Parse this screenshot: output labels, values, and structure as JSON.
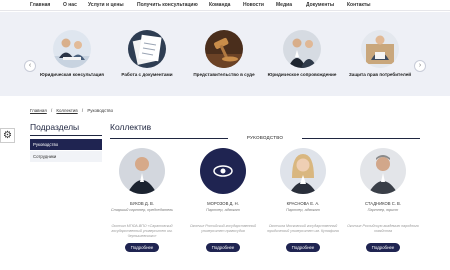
{
  "nav": {
    "items": [
      "Главная",
      "О нас",
      "Услуги и цены",
      "Получить консультацию",
      "Команда",
      "Новости",
      "Медиа",
      "Документы",
      "Контакты"
    ]
  },
  "services": {
    "prev_icon": "‹",
    "next_icon": "›",
    "items": [
      {
        "label": "Юридическая консультация"
      },
      {
        "label": "Работа с документами"
      },
      {
        "label": "Представительство в суде"
      },
      {
        "label": "Юридическое сопровождение"
      },
      {
        "label": "Защита прав потребителей"
      }
    ]
  },
  "breadcrumbs": [
    "Главная",
    "/",
    "Коллектив",
    "/",
    "Руководство"
  ],
  "settings_icon": "⚙",
  "sidebar": {
    "title": "Подразделы",
    "items": [
      "Руководство",
      "Сотрудники"
    ]
  },
  "main": {
    "title": "Коллектив",
    "subtitle": "РУКОВОДСТВО"
  },
  "team": [
    {
      "name": "БУКОВ Д. В.",
      "position": "Старший партнер, председатель",
      "description": "Окончил МГЮА-ВПО «Саратовский государственный университет им. Чернышевского»",
      "button": "Подробнее"
    },
    {
      "name": "МОРОЗОВ Д. Н.",
      "position": "Партнер, адвокат",
      "description": "Окончил Российский государственный университет правосудия",
      "button": "Подробнее"
    },
    {
      "name": "КРАСНОВА Е. А.",
      "position": "Партнер, адвокат",
      "description": "Окончила Московский государственный юридический университет им. Кутафина",
      "button": "Подробнее"
    },
    {
      "name": "СТАДНИКОВ С. В.",
      "position": "Партнер, юрист",
      "description": "Окончил Российскую академию народного хозяйства",
      "button": "Подробнее"
    }
  ],
  "colors": {
    "accent": "#1f2451",
    "band": "#eef0f6"
  }
}
